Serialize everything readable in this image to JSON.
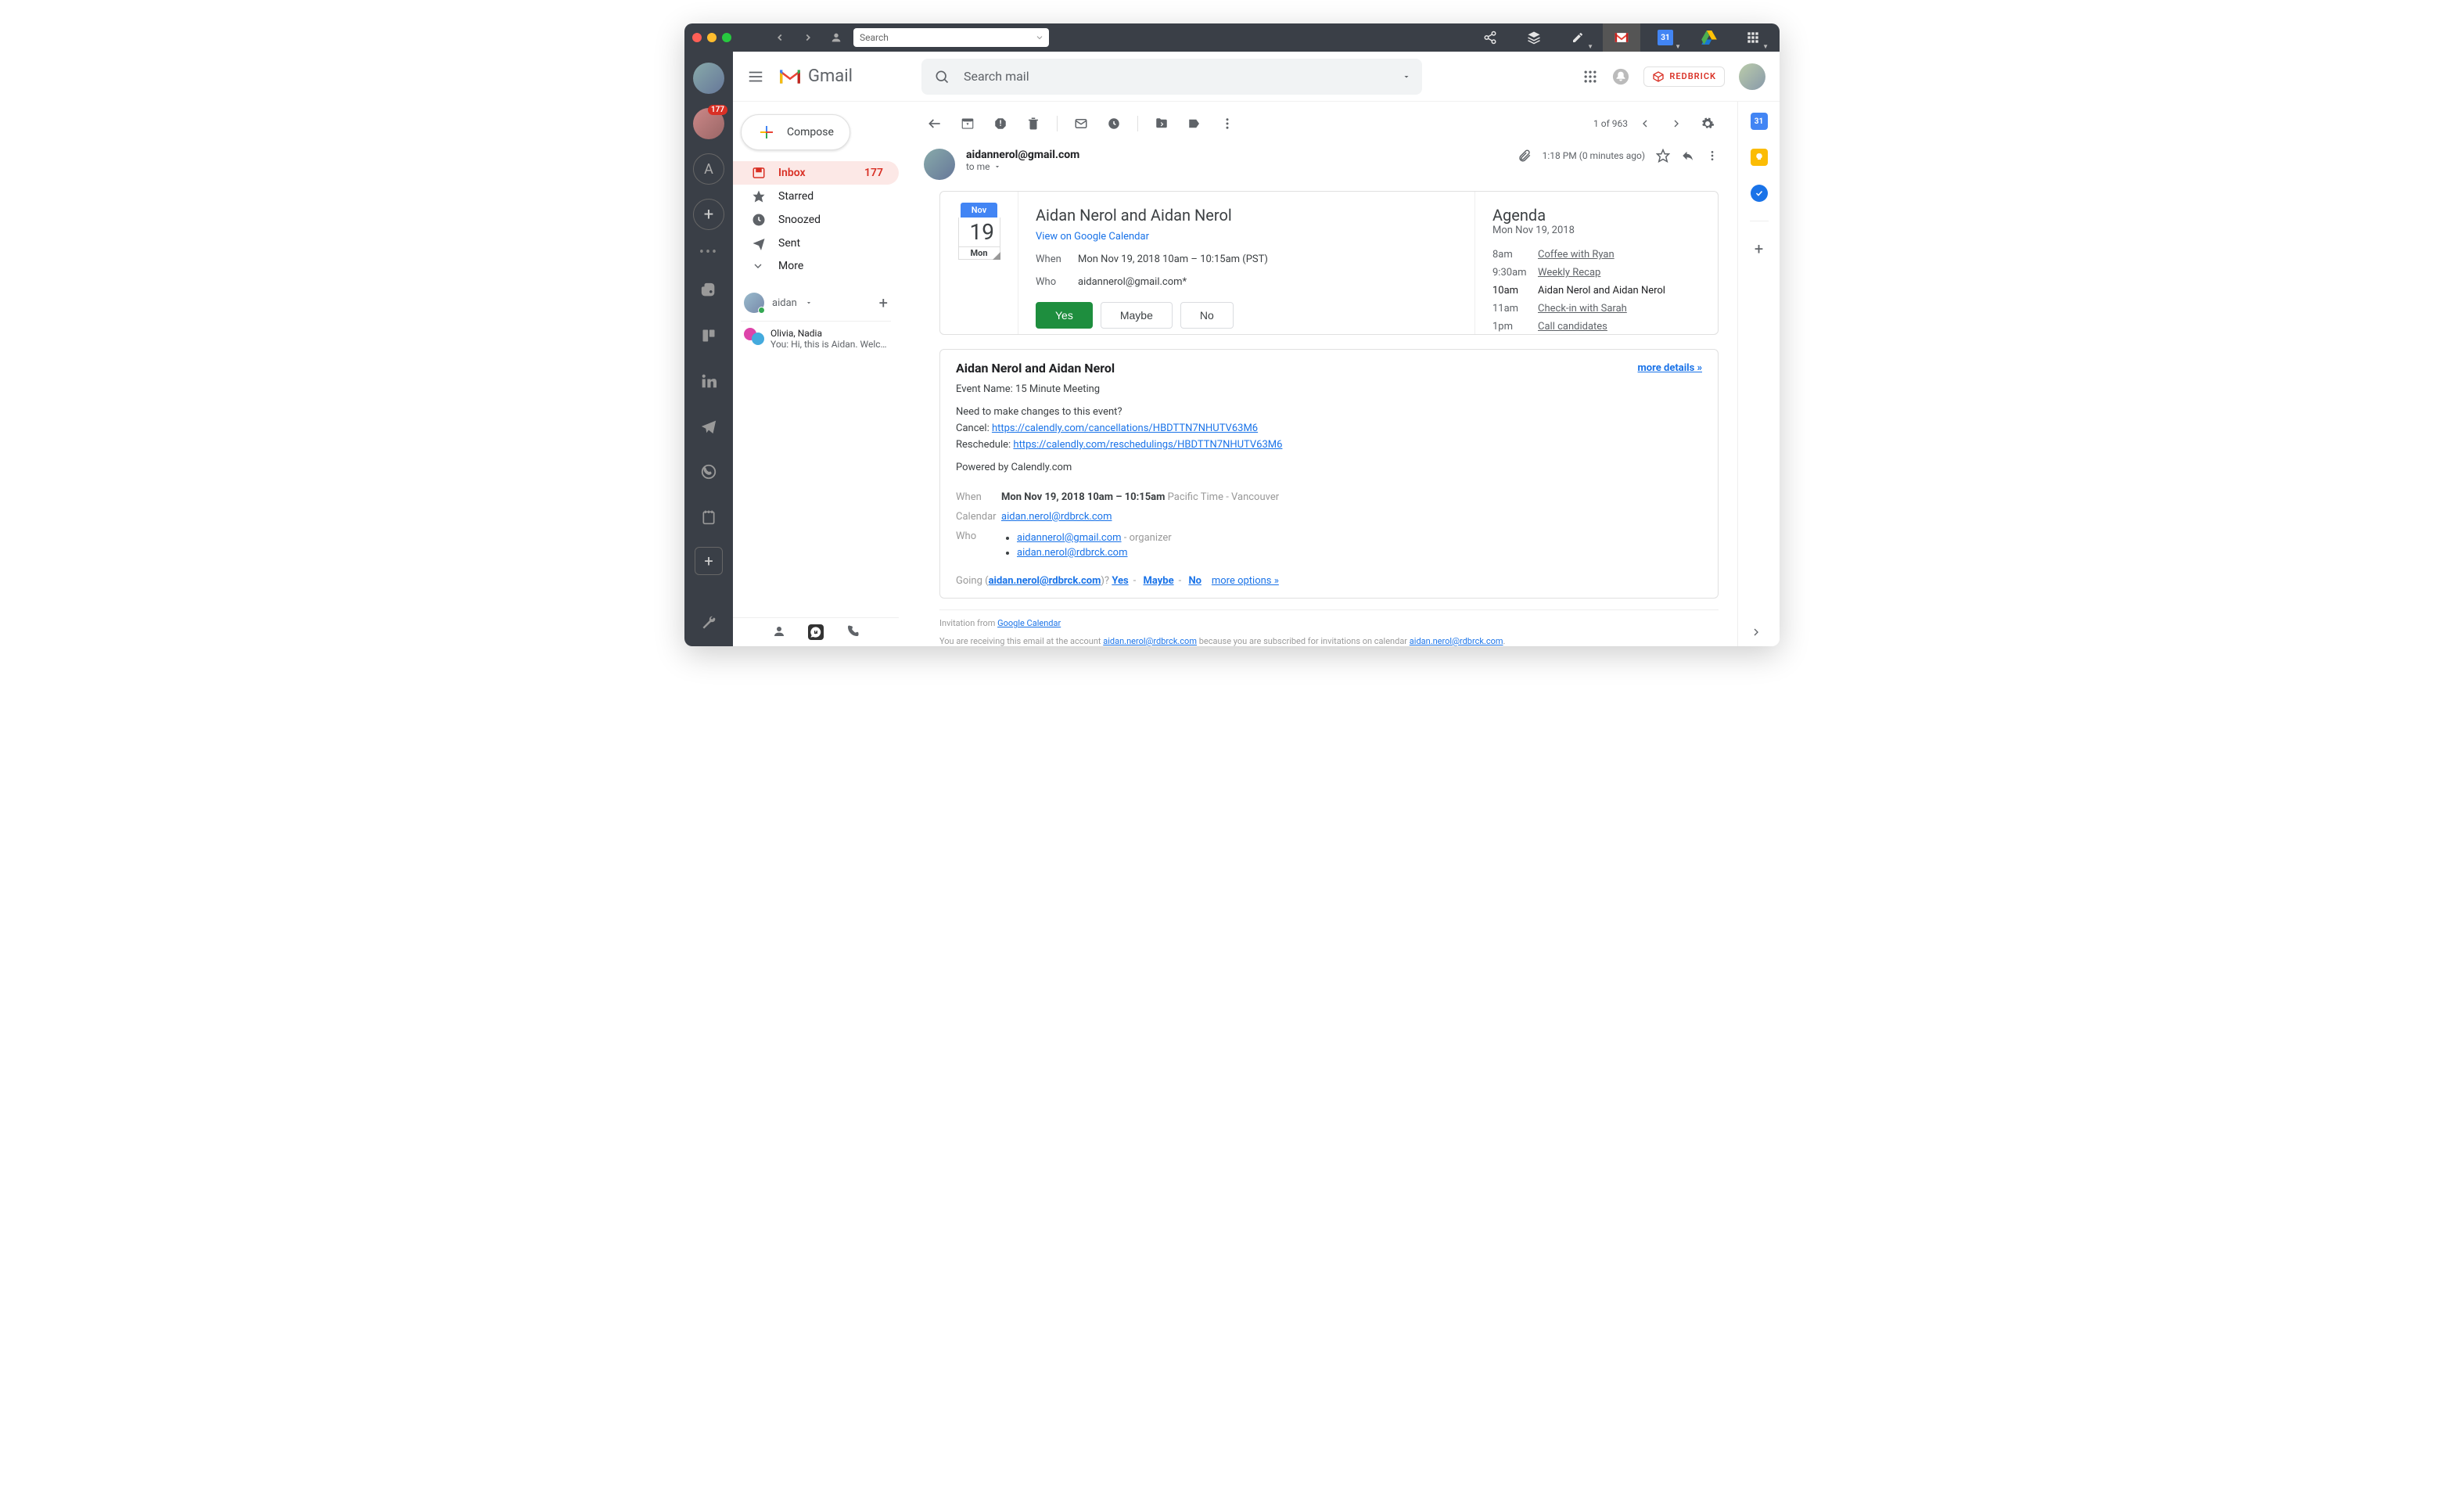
{
  "titlebar": {
    "search_placeholder": "Search"
  },
  "app_rail": {
    "badge": "177",
    "letter": "A"
  },
  "gmail_header": {
    "brand": "Gmail",
    "search_placeholder": "Search mail",
    "org": "REDBRICK"
  },
  "compose_label": "Compose",
  "folders": [
    {
      "icon": "inbox",
      "label": "Inbox",
      "count": "177",
      "active": true
    },
    {
      "icon": "star",
      "label": "Starred",
      "count": "",
      "active": false
    },
    {
      "icon": "clock",
      "label": "Snoozed",
      "count": "",
      "active": false
    },
    {
      "icon": "send",
      "label": "Sent",
      "count": "",
      "active": false
    },
    {
      "icon": "more",
      "label": "More",
      "count": "",
      "active": false
    }
  ],
  "chat": {
    "user": "aidan",
    "thread_names": "Olivia, Nadia",
    "thread_preview": "You: Hi, this is Aidan. Welcome to my"
  },
  "toolbar": {
    "position": "1 of 963"
  },
  "message": {
    "sender": "aidannerol@gmail.com",
    "to": "to me",
    "time": "1:18 PM (0 minutes ago)"
  },
  "calendar_card": {
    "month": "Nov",
    "day": "19",
    "dow": "Mon",
    "title": "Aidan Nerol and Aidan Nerol",
    "view_link": "View on Google Calendar",
    "when_label": "When",
    "when_value": "Mon Nov 19, 2018 10am – 10:15am (PST)",
    "who_label": "Who",
    "who_value": "aidannerol@gmail.com*",
    "btn_yes": "Yes",
    "btn_maybe": "Maybe",
    "btn_no": "No"
  },
  "agenda": {
    "title": "Agenda",
    "date": "Mon Nov 19, 2018",
    "items": [
      {
        "time": "8am",
        "event": "Coffee with Ryan",
        "current": false
      },
      {
        "time": "9:30am",
        "event": "Weekly Recap",
        "current": false
      },
      {
        "time": "10am",
        "event": "Aidan Nerol and Aidan Nerol",
        "current": true
      },
      {
        "time": "11am",
        "event": "Check-in with Sarah",
        "current": false
      },
      {
        "time": "1pm",
        "event": "Call candidates",
        "current": false
      }
    ]
  },
  "details": {
    "title": "Aidan Nerol and Aidan Nerol",
    "more": "more details »",
    "event_name_label": "Event Name: ",
    "event_name": "15 Minute Meeting",
    "change_q": "Need to make changes to this event?",
    "cancel_label": "Cancel: ",
    "cancel_link": "https://calendly.com/cancellations/HBDTTN7NHUTV63M6",
    "resched_label": "Reschedule: ",
    "resched_link": "https://calendly.com/reschedulings/HBDTTN7NHUTV63M6",
    "powered": "Powered by Calendly.com",
    "when_label": "When",
    "when_main": "Mon Nov 19, 2018 10am – 10:15am",
    "when_tz": " Pacific Time - Vancouver",
    "cal_label": "Calendar",
    "cal_value": "aidan.nerol@rdbrck.com",
    "who_label": "Who",
    "who_1": "aidannerol@gmail.com",
    "who_1_suffix": " - organizer",
    "who_2": "aidan.nerol@rdbrck.com",
    "going_prefix": "Going (",
    "going_email": "aidan.nerol@rdbrck.com",
    "going_suffix": ")?   ",
    "going_yes": "Yes",
    "going_maybe": "Maybe",
    "going_no": "No",
    "going_more": "more options »"
  },
  "footer": {
    "inv_from": "Invitation from ",
    "inv_link": "Google Calendar",
    "receiving_1": "You are receiving this email at the account ",
    "receiving_email": "aidan.nerol@rdbrck.com",
    "receiving_2": " because you are subscribed for invitations on calendar ",
    "receiving_cal": "aidan.nerol@rdbrck.com"
  },
  "side_panel": {
    "cal": "31"
  }
}
